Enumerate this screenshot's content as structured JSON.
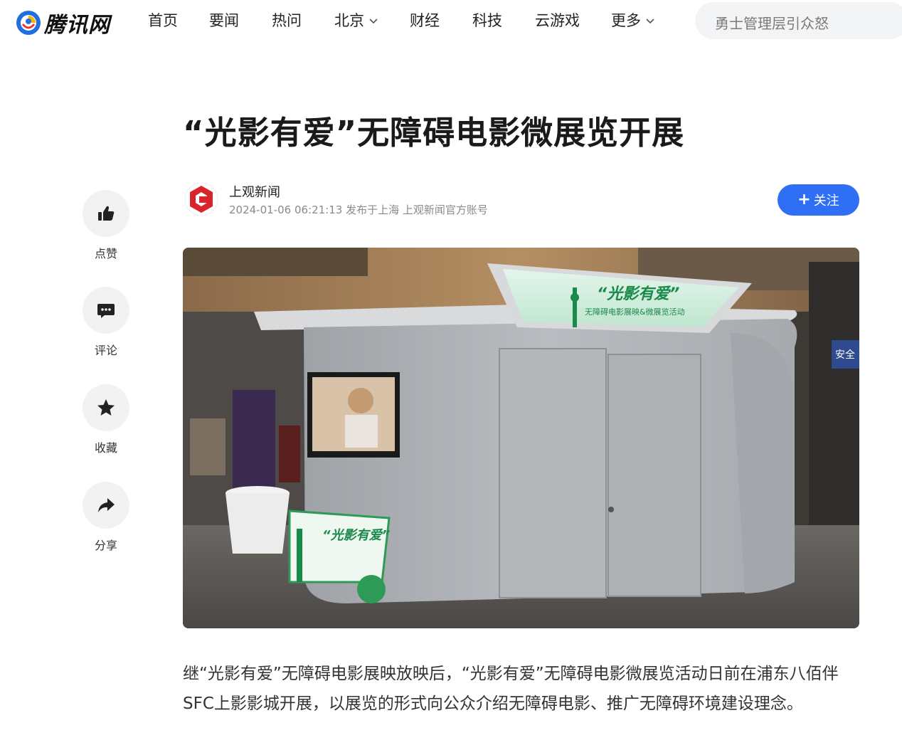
{
  "header": {
    "logo_text": "腾讯网",
    "nav": [
      {
        "label": "首页",
        "dropdown": false
      },
      {
        "label": "要闻",
        "dropdown": false
      },
      {
        "label": "热问",
        "dropdown": false
      },
      {
        "label": "北京",
        "dropdown": true
      },
      {
        "label": "财经",
        "dropdown": false
      },
      {
        "label": "科技",
        "dropdown": false
      },
      {
        "label": "云游戏",
        "dropdown": false
      },
      {
        "label": "更多",
        "dropdown": true
      }
    ],
    "search_placeholder": "勇士管理层引众怒"
  },
  "article": {
    "title": "“光影有爱”无障碍电影微展览开展",
    "author": {
      "name": "上观新闻",
      "meta": "2024-01-06 06:21:13 发布于上海 上观新闻官方账号"
    },
    "follow_label": "关注",
    "image_signage": {
      "headline": "“光影有爱”",
      "subline": "无障碍电影展映&微展览活动",
      "wall_sign": "安全"
    },
    "paragraph": "继“光影有爱”无障碍电影展映放映后，“光影有爱”无障碍电影微展览活动日前在浦东八佰伴SFC上影影城开展，以展览的形式向公众介绍无障碍电影、推广无障碍环境建设理念。"
  },
  "actions": [
    {
      "label": "点赞",
      "icon": "thumbs-up-icon"
    },
    {
      "label": "评论",
      "icon": "comment-icon"
    },
    {
      "label": "收藏",
      "icon": "star-icon"
    },
    {
      "label": "分享",
      "icon": "share-icon"
    }
  ],
  "colors": {
    "accent": "#2f6ff6",
    "logo_blue": "#1f6fe0",
    "logo_yellow": "#f6b500",
    "author_red": "#d9232d"
  }
}
